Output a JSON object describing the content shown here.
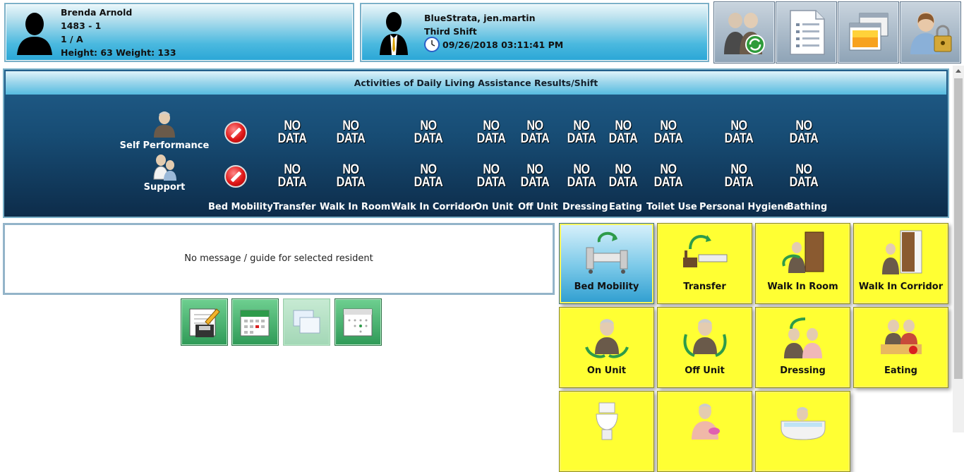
{
  "resident": {
    "name": "Brenda Arnold",
    "id": "1483 - 1",
    "room": "1 / A",
    "measurements": "Height: 63 Weight: 133"
  },
  "staff": {
    "name": "BlueStrata, jen.martin",
    "shift": "Third Shift",
    "datetime": "09/26/2018 03:11:41 PM"
  },
  "header_buttons": [
    "switch-resident-icon",
    "list-document-icon",
    "windows-gallery-icon",
    "user-lock-icon"
  ],
  "adl": {
    "title": "Activities of Daily Living Assistance Results/Shift",
    "rows": [
      {
        "label": "Self Performance",
        "icon": "elderly-person-icon"
      },
      {
        "label": "Support",
        "icon": "assistance-icon"
      }
    ],
    "columns": [
      "Bed Mobility",
      "Transfer",
      "Walk In Room",
      "Walk In Corridor",
      "On Unit",
      "Off Unit",
      "Dressing",
      "Eating",
      "Toilet Use",
      "Personal Hygiene",
      "Bathing"
    ],
    "no_data_line1": "NO",
    "no_data_line2": "DATA"
  },
  "message": "No message / guide for selected resident",
  "action_buttons": [
    {
      "icon": "save-notes-icon",
      "enabled": true
    },
    {
      "icon": "calendar-icon",
      "enabled": true
    },
    {
      "icon": "windows-icon",
      "enabled": false
    },
    {
      "icon": "schedule-grid-icon",
      "enabled": true
    }
  ],
  "tiles": [
    {
      "label": "Bed Mobility",
      "selected": true
    },
    {
      "label": "Transfer",
      "selected": false
    },
    {
      "label": "Walk In Room",
      "selected": false
    },
    {
      "label": "Walk In Corridor",
      "selected": false
    },
    {
      "label": "On Unit",
      "selected": false
    },
    {
      "label": "Off Unit",
      "selected": false
    },
    {
      "label": "Dressing",
      "selected": false
    },
    {
      "label": "Eating",
      "selected": false
    },
    {
      "label": "",
      "selected": false
    },
    {
      "label": "",
      "selected": false
    },
    {
      "label": "",
      "selected": false
    }
  ],
  "colors": {
    "tile_yellow": "#ffff33",
    "board_navy": "#174c74",
    "header_blue": "#2aa6d6",
    "action_green": "#2f9a57"
  }
}
